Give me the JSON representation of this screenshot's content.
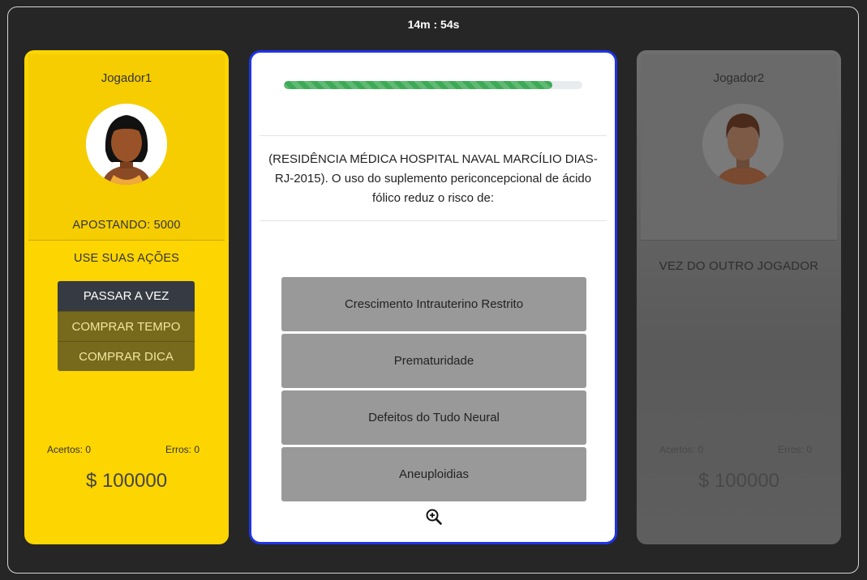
{
  "timer": "14m : 54s",
  "player1": {
    "name": "Jogador1",
    "betting": "APOSTANDO: 5000",
    "actions_title": "USE SUAS AÇÕES",
    "pass_label": "PASSAR A VEZ",
    "buy_time_label": "COMPRAR TEMPO",
    "buy_hint_label": "COMPRAR DICA",
    "hits": "Acertos: 0",
    "errors": "Erros: 0",
    "money": "$ 100000"
  },
  "player2": {
    "name": "Jogador2",
    "status": "VEZ DO OUTRO JOGADOR",
    "hits": "Acertos: 0",
    "errors": "Erros: 0",
    "money": "$ 100000"
  },
  "question": {
    "progress": 0.9,
    "text": "(RESIDÊNCIA MÉDICA HOSPITAL NAVAL MARCÍLIO DIAS-RJ-2015). O uso do suplemento periconcepcional de ácido fólico reduz o risco de:",
    "answers": [
      "Crescimento Intrauterino Restrito",
      "Prematuridade",
      "Defeitos do Tudo Neural",
      "Aneuploidias"
    ],
    "zoom_icon": "zoom-in-icon"
  },
  "colors": {
    "background": "#262626",
    "player1_card": "#fdd500",
    "player2_card": "#6e6e6e",
    "card_border": "#1e35e6",
    "progress": "#3daa55",
    "answer_bg": "#999999"
  }
}
